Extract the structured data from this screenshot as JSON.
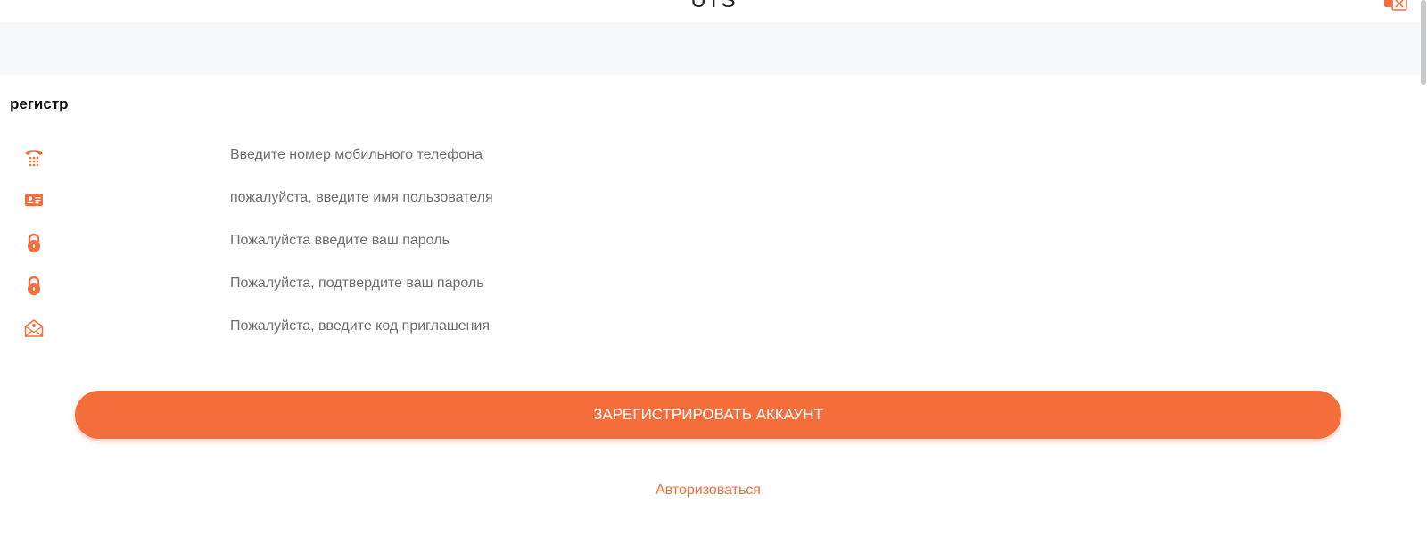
{
  "header": {
    "title": "UTS",
    "language_icon": "translate-icon"
  },
  "form": {
    "title": "регистр",
    "fields": [
      {
        "icon": "phone-icon",
        "placeholder": "Введите номер мобильного телефона",
        "value": ""
      },
      {
        "icon": "id-card-icon",
        "placeholder": "пожалуйста, введите имя пользователя",
        "value": ""
      },
      {
        "icon": "lock-icon",
        "placeholder": "Пожалуйста введите ваш пароль",
        "value": ""
      },
      {
        "icon": "lock-icon",
        "placeholder": "Пожалуйста, подтвердите ваш пароль",
        "value": ""
      },
      {
        "icon": "envelope-icon",
        "placeholder": "Пожалуйста, введите код приглашения",
        "value": ""
      }
    ],
    "submit_label": "ЗАРЕГИСТРИРОВАТЬ АККАУНТ",
    "login_link": "Авторизоваться"
  },
  "colors": {
    "accent": "#f46e3c",
    "band": "#f8f9fb"
  }
}
